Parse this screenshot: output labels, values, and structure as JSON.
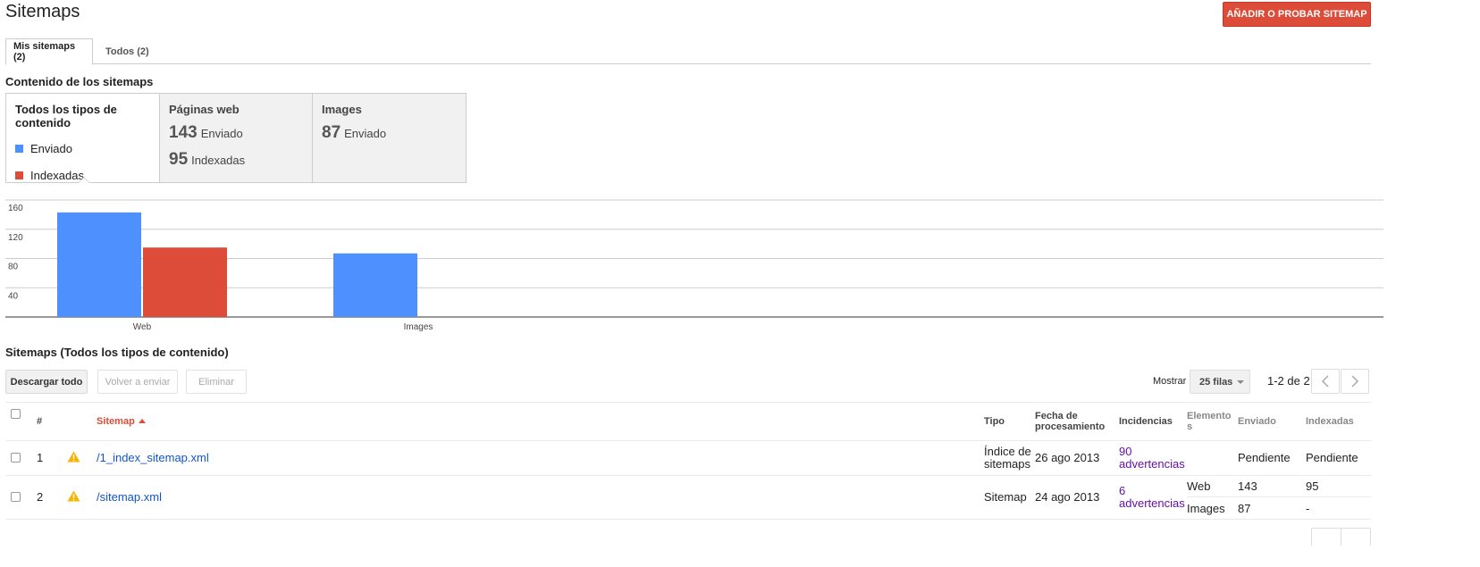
{
  "page": {
    "title": "Sitemaps",
    "add_button": "AÑADIR O PROBAR SITEMAP"
  },
  "tabs": [
    {
      "label": "Mis sitemaps (2)",
      "active": true
    },
    {
      "label": "Todos (2)",
      "active": false
    }
  ],
  "content_section": {
    "title": "Contenido de los sitemaps",
    "all_types": {
      "heading": "Todos los tipos de contenido",
      "legend": [
        {
          "label": "Enviado",
          "color": "#4d90fe"
        },
        {
          "label": "Indexadas",
          "color": "#dd4b39"
        }
      ]
    },
    "web": {
      "heading": "Páginas web",
      "submitted_value": "143",
      "submitted_label": "Enviado",
      "indexed_value": "95",
      "indexed_label": "Indexadas"
    },
    "images": {
      "heading": "Images",
      "submitted_value": "87",
      "submitted_label": "Enviado"
    }
  },
  "chart_data": {
    "type": "bar",
    "categories": [
      "Web",
      "Images"
    ],
    "series": [
      {
        "name": "Enviado",
        "values": [
          143,
          87
        ],
        "color": "#4d90fe"
      },
      {
        "name": "Indexadas",
        "values": [
          95,
          null
        ],
        "color": "#dd4b39"
      }
    ],
    "yticks": [
      40,
      80,
      120,
      160
    ],
    "ylim": [
      0,
      160
    ],
    "grid": true
  },
  "sitemaps_section": {
    "title": "Sitemaps (Todos los tipos de contenido)",
    "toolbar": {
      "download_all": "Descargar todo",
      "resubmit": "Volver a enviar",
      "delete": "Eliminar"
    },
    "pagination": {
      "show_label": "Mostrar",
      "rows_option": "25 filas",
      "range": "1-2 de 2"
    },
    "columns": {
      "num": "#",
      "sitemap": "Sitemap",
      "type": "Tipo",
      "processed": "Fecha de procesamiento",
      "issues": "Incidencias",
      "items": "Elementos",
      "submitted": "Enviado",
      "indexed": "Indexadas"
    },
    "rows": [
      {
        "num": "1",
        "path": "/1_index_sitemap.xml",
        "type": "Índice de sitemaps",
        "date": "26 ago 2013",
        "issues": "90 advertencias",
        "items": [
          {
            "kind": "",
            "submitted": "Pendiente",
            "indexed": "Pendiente"
          }
        ]
      },
      {
        "num": "2",
        "path": "/sitemap.xml",
        "type": "Sitemap",
        "date": "24 ago 2013",
        "issues": "6 advertencias",
        "items": [
          {
            "kind": "Web",
            "submitted": "143",
            "indexed": "95"
          },
          {
            "kind": "Images",
            "submitted": "87",
            "indexed": "-"
          }
        ]
      }
    ]
  },
  "icons": {
    "warning": "warning-icon",
    "prev": "chevron-left-icon",
    "next": "chevron-right-icon",
    "dropdown": "chevron-down-icon"
  }
}
